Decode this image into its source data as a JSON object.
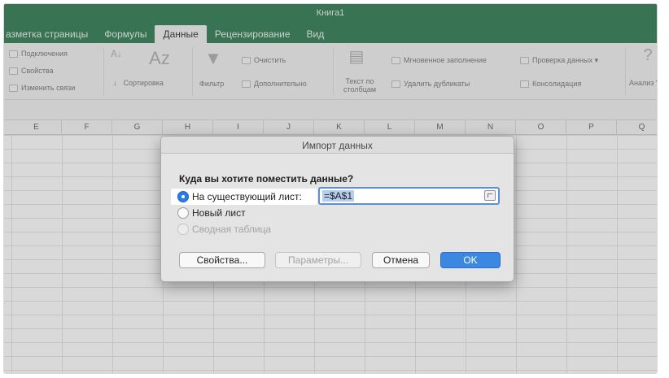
{
  "window": {
    "title": "Книга1"
  },
  "tabs": [
    {
      "label": "азметка страницы",
      "active": false
    },
    {
      "label": "Формулы",
      "active": false
    },
    {
      "label": "Данные",
      "active": true
    },
    {
      "label": "Рецензирование",
      "active": false
    },
    {
      "label": "Вид",
      "active": false
    }
  ],
  "ribbon": {
    "connections": {
      "connections": "Подключения",
      "properties": "Свойства",
      "edit_links": "Изменить связи"
    },
    "sort": {
      "sort_icon": "Az",
      "sort_label": "Сортировка"
    },
    "filter": {
      "filter_label": "Фильтр",
      "clear": "Очистить",
      "advanced": "Дополнительно"
    },
    "tools": {
      "text_to_columns": "Текст по столбцам",
      "flash_fill": "Мгновенное заполнение",
      "remove_duplicates": "Удалить дубликаты",
      "data_validation": "Проверка данных ▾",
      "consolidate": "Консолидация",
      "whatif": "Анализ \"что если\""
    }
  },
  "columns": [
    "E",
    "F",
    "G",
    "H",
    "I",
    "J",
    "K",
    "L",
    "M",
    "N",
    "O",
    "P",
    "Q"
  ],
  "dialog": {
    "title": "Импорт данных",
    "question": "Куда вы хотите поместить данные?",
    "options": [
      {
        "label": "На существующий лист:",
        "checked": true,
        "disabled": false
      },
      {
        "label": "Новый лист",
        "checked": false,
        "disabled": false
      },
      {
        "label": "Сводная таблица",
        "checked": false,
        "disabled": true
      }
    ],
    "reference_value": "=$A$1",
    "buttons": {
      "properties": "Свойства...",
      "parameters": "Параметры...",
      "cancel": "Отмена",
      "ok": "OK"
    }
  },
  "colors": {
    "brand_green": "#217346",
    "accent_blue": "#3c87e2"
  }
}
